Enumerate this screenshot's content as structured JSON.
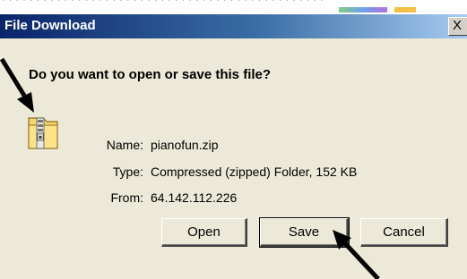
{
  "dialog": {
    "title": "File Download",
    "close_symbol": "X",
    "question": "Do you want to open or save this file?",
    "icon": "zip-folder-icon",
    "fields": [
      {
        "label": "Name:",
        "value": "pianofun.zip"
      },
      {
        "label": "Type:",
        "value": "Compressed (zipped) Folder, 152 KB"
      },
      {
        "label": "From:",
        "value": "64.142.112.226"
      }
    ],
    "buttons": {
      "open": "Open",
      "save": "Save",
      "cancel": "Cancel"
    }
  },
  "annotations": {
    "arrows": [
      "pointer-arrow-to-icon",
      "pointer-arrow-to-save"
    ]
  },
  "colors": {
    "titlebar_start": "#0a246a",
    "titlebar_end": "#a6caf0",
    "dialog_bg": "#ece9d8"
  }
}
